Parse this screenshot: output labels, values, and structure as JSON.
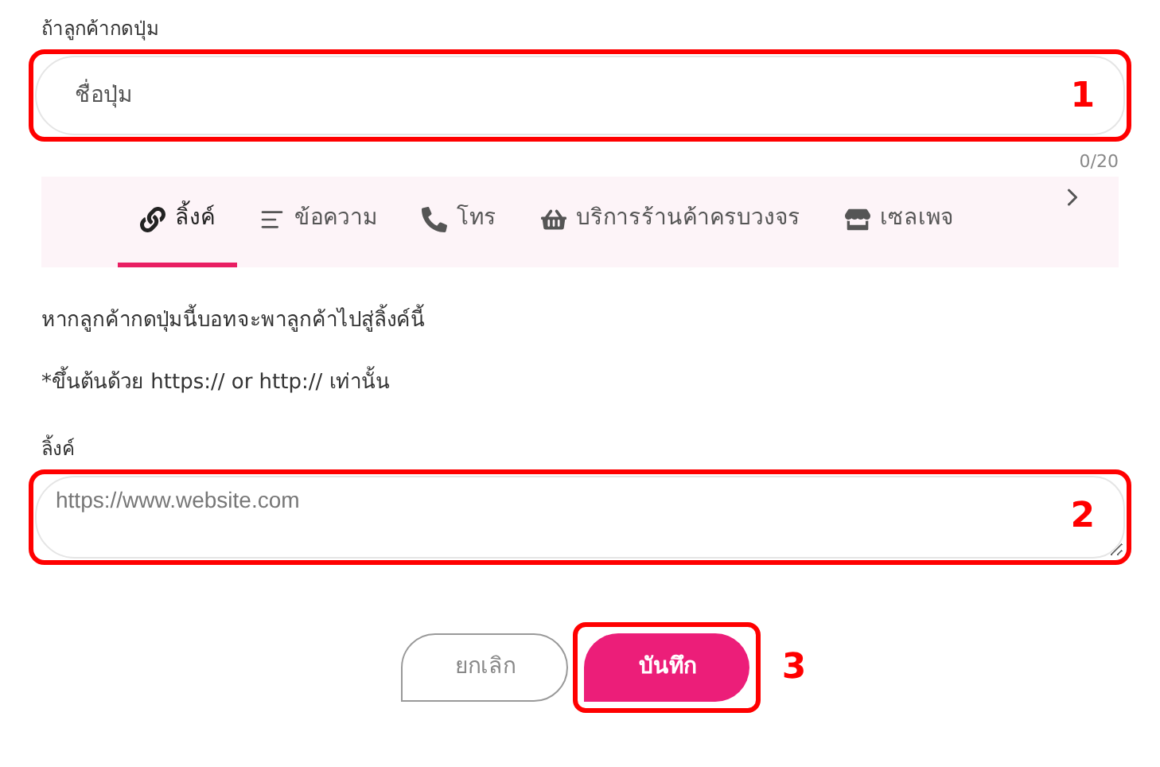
{
  "name_field": {
    "label": "ถ้าลูกค้ากดปุ่ม",
    "placeholder": "ชื่อปุ่ม",
    "counter": "0/20",
    "callout": "1"
  },
  "tabs": [
    {
      "kind": "link",
      "label": "ลิ้งค์",
      "selected": true
    },
    {
      "kind": "text",
      "label": "ข้อความ",
      "selected": false
    },
    {
      "kind": "phone",
      "label": "โทร",
      "selected": false
    },
    {
      "kind": "basket",
      "label": "บริการร้านค้าครบวงจร",
      "selected": false
    },
    {
      "kind": "store",
      "label": "เซลเพจ",
      "selected": false
    }
  ],
  "description": "หากลูกค้ากดปุ่มนี้บอทจะพาลูกค้าไปสู่ลิ้งค์นี้",
  "note": "*ขึ้นต้นด้วย https:// or http:// เท่านั้น",
  "link_field": {
    "label": "ลิ้งค์",
    "placeholder": "https://www.website.com",
    "callout": "2"
  },
  "buttons": {
    "cancel": "ยกเลิก",
    "save": "บันทึก",
    "callout": "3"
  }
}
